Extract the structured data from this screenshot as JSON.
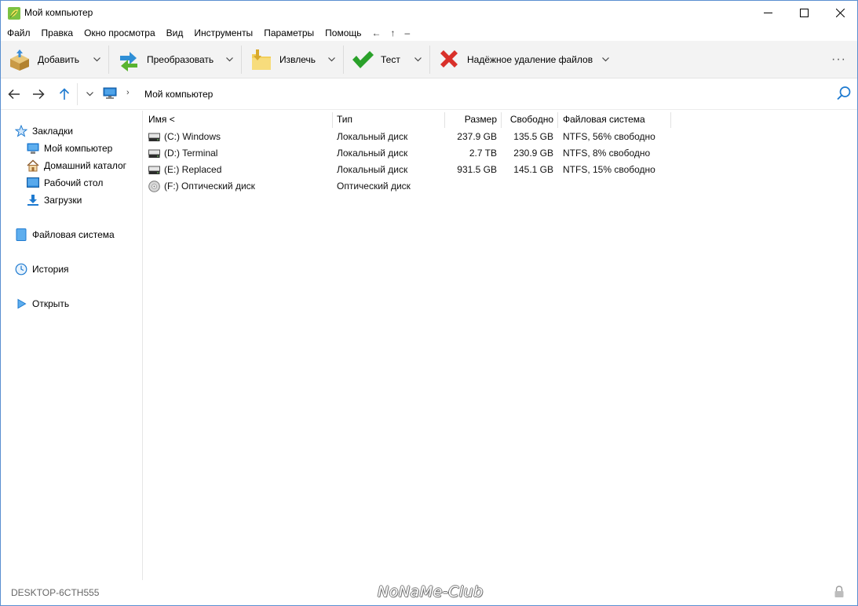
{
  "window": {
    "title": "Мой компьютер"
  },
  "menu": {
    "items": [
      "Файл",
      "Правка",
      "Окно просмотра",
      "Вид",
      "Инструменты",
      "Параметры",
      "Помощь"
    ],
    "extras": [
      "←",
      "↑",
      "–"
    ]
  },
  "toolbar": {
    "add_label": "Добавить",
    "convert_label": "Преобразовать",
    "extract_label": "Извлечь",
    "test_label": "Тест",
    "wipe_label": "Надёжное удаление файлов",
    "more": "···"
  },
  "address": {
    "path": "Мой компьютер",
    "chevron": "›"
  },
  "sidebar": {
    "bookmarks_label": "Закладки",
    "items": [
      {
        "label": "Мой компьютер",
        "icon": "computer-icon"
      },
      {
        "label": "Домашний каталог",
        "icon": "home-icon"
      },
      {
        "label": "Рабочий стол",
        "icon": "desktop-icon"
      },
      {
        "label": "Загрузки",
        "icon": "download-icon"
      }
    ],
    "filesystem_label": "Файловая система",
    "history_label": "История",
    "open_label": "Открыть"
  },
  "table": {
    "headers": {
      "name": "Имя <",
      "type": "Тип",
      "size": "Размер",
      "free": "Свободно",
      "fs": "Файловая система"
    },
    "rows": [
      {
        "name": "(C:) Windows",
        "type": "Локальный диск",
        "size": "237.9 GB",
        "free": "135.5 GB",
        "fs": "NTFS, 56% свободно",
        "icon": "hard-drive-icon"
      },
      {
        "name": "(D:) Terminal",
        "type": "Локальный диск",
        "size": "2.7 TB",
        "free": "230.9 GB",
        "fs": "NTFS, 8% свободно",
        "icon": "hard-drive-icon"
      },
      {
        "name": "(E:) Replaced",
        "type": "Локальный диск",
        "size": "931.5 GB",
        "free": "145.1 GB",
        "fs": "NTFS, 15% свободно",
        "icon": "hard-drive-icon"
      },
      {
        "name": "(F:) Оптический диск",
        "type": "Оптический диск",
        "size": "",
        "free": "",
        "fs": "",
        "icon": "optical-disc-icon"
      }
    ]
  },
  "status": {
    "computer_name": "DESKTOP-6CTH555",
    "watermark": "NoNaMe-Club"
  },
  "colors": {
    "accent": "#1e7ad0",
    "toolbar_bg": "#f3f3f3",
    "test_green": "#2aa12a",
    "wipe_red": "#d9302a"
  }
}
